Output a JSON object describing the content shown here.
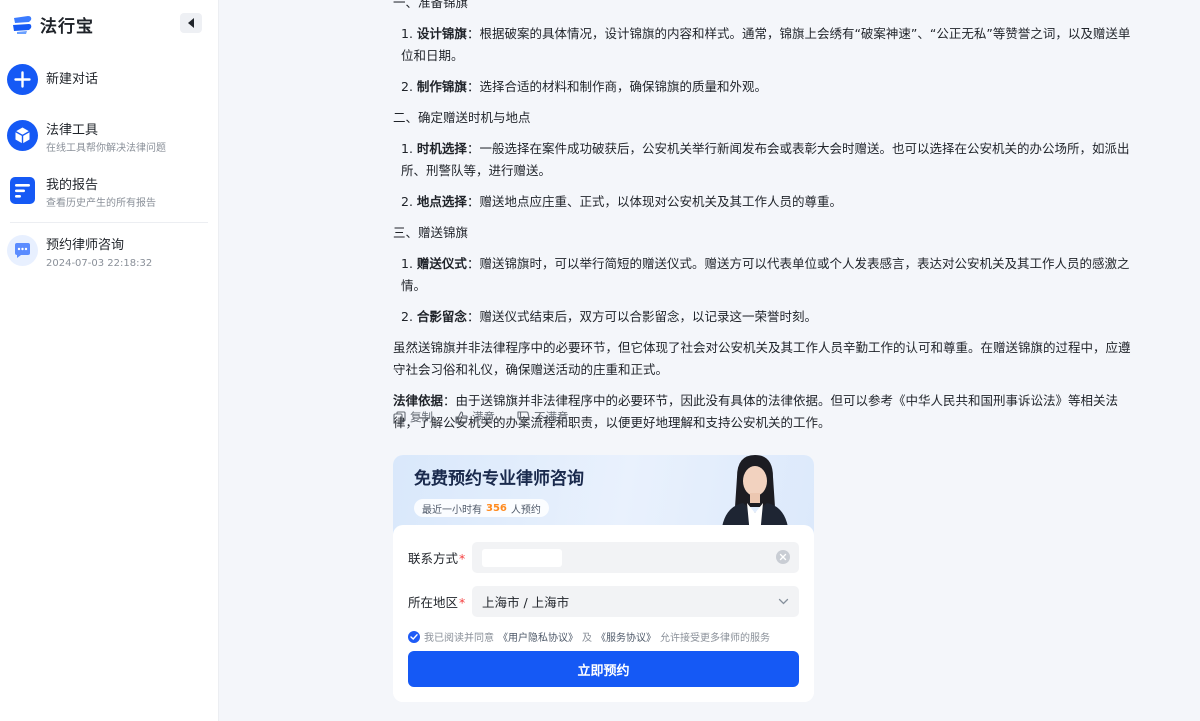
{
  "app": {
    "name": "法行宝"
  },
  "sidebar": {
    "new_chat": {
      "label": "新建对话"
    },
    "legal_tools": {
      "label": "法律工具",
      "sub": "在线工具帮你解决法律问题"
    },
    "my_reports": {
      "label": "我的报告",
      "sub": "查看历史产生的所有报告"
    },
    "history": [
      {
        "label": "预约律师咨询",
        "time": "2024-07-03 22:18:32"
      }
    ]
  },
  "answer": {
    "section0_heading": "一、准备锦旗",
    "section1_items": [
      {
        "num": "1.",
        "term": "设计锦旗",
        "text": "：根据破案的具体情况，设计锦旗的内容和样式。通常，锦旗上会绣有“破案神速”、“公正无私”等赞誉之词，以及赠送单位和日期。"
      },
      {
        "num": "2.",
        "term": "制作锦旗",
        "text": "：选择合适的材料和制作商，确保锦旗的质量和外观。"
      }
    ],
    "section2_heading": "二、确定赠送时机与地点",
    "section2_items": [
      {
        "num": "1.",
        "term": "时机选择",
        "text": "：一般选择在案件成功破获后，公安机关举行新闻发布会或表彰大会时赠送。也可以选择在公安机关的办公场所，如派出所、刑警队等，进行赠送。"
      },
      {
        "num": "2.",
        "term": "地点选择",
        "text": "：赠送地点应庄重、正式，以体现对公安机关及其工作人员的尊重。"
      }
    ],
    "section3_heading": "三、赠送锦旗",
    "section3_items": [
      {
        "num": "1.",
        "term": "赠送仪式",
        "text": "：赠送锦旗时，可以举行简短的赠送仪式。赠送方可以代表单位或个人发表感言，表达对公安机关及其工作人员的感激之情。"
      },
      {
        "num": "2.",
        "term": "合影留念",
        "text": "：赠送仪式结束后，双方可以合影留念，以记录这一荣誉时刻。"
      }
    ],
    "summary": "虽然送锦旗并非法律程序中的必要环节，但它体现了社会对公安机关及其工作人员辛勤工作的认可和尊重。在赠送锦旗的过程中，应遵守社会习俗和礼仪，确保赠送活动的庄重和正式。",
    "basis_label": "法律依据",
    "basis_text": "：由于送锦旗并非法律程序中的必要环节，因此没有具体的法律依据。但可以参考《中华人民共和国刑事诉讼法》等相关法律，了解公安机关的办案流程和职责，以便更好地理解和支持公安机关的工作。"
  },
  "actions": {
    "copy": "复制",
    "like": "满意",
    "dislike": "不满意"
  },
  "booking": {
    "title": "免费预约专业律师咨询",
    "pill_prefix": "最近一小时有",
    "pill_count": "356",
    "pill_suffix": "人预约",
    "contact_label": "联系方式",
    "region_label": "所在地区",
    "region_value": "上海市 / 上海市",
    "agree_prefix": "我已阅读并同意",
    "privacy_link": "《用户隐私协议》",
    "agree_and": "及",
    "service_link": "《服务协议》",
    "agree_suffix": "允许接受更多律师的服务",
    "submit": "立即预约",
    "colors": {
      "accent": "#1559f5",
      "highlight": "#ff8a1f",
      "required": "#f53f3f"
    }
  }
}
